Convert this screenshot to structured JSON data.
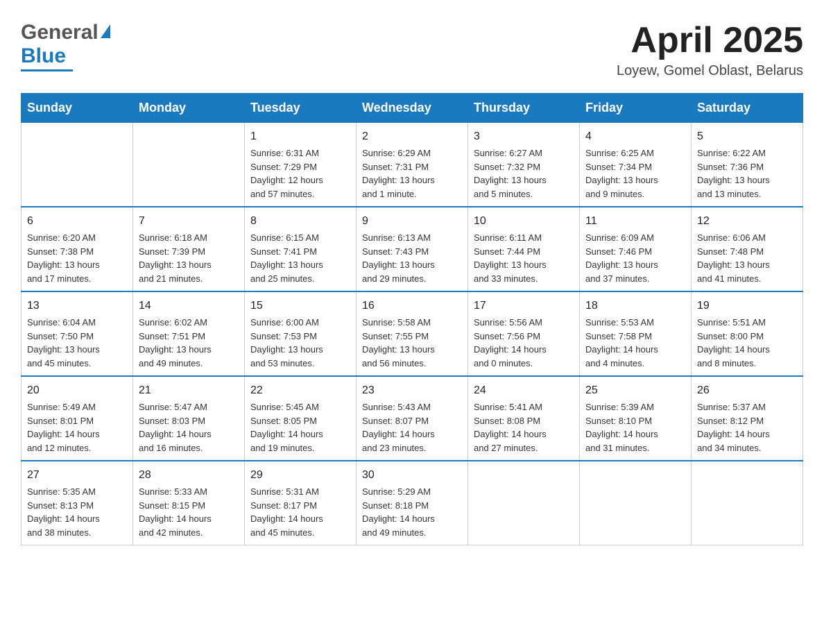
{
  "header": {
    "logo_text1": "General",
    "logo_text2": "Blue",
    "title": "April 2025",
    "subtitle": "Loyew, Gomel Oblast, Belarus"
  },
  "calendar": {
    "days_of_week": [
      "Sunday",
      "Monday",
      "Tuesday",
      "Wednesday",
      "Thursday",
      "Friday",
      "Saturday"
    ],
    "weeks": [
      {
        "days": [
          {
            "number": "",
            "info": ""
          },
          {
            "number": "",
            "info": ""
          },
          {
            "number": "1",
            "info": "Sunrise: 6:31 AM\nSunset: 7:29 PM\nDaylight: 12 hours\nand 57 minutes."
          },
          {
            "number": "2",
            "info": "Sunrise: 6:29 AM\nSunset: 7:31 PM\nDaylight: 13 hours\nand 1 minute."
          },
          {
            "number": "3",
            "info": "Sunrise: 6:27 AM\nSunset: 7:32 PM\nDaylight: 13 hours\nand 5 minutes."
          },
          {
            "number": "4",
            "info": "Sunrise: 6:25 AM\nSunset: 7:34 PM\nDaylight: 13 hours\nand 9 minutes."
          },
          {
            "number": "5",
            "info": "Sunrise: 6:22 AM\nSunset: 7:36 PM\nDaylight: 13 hours\nand 13 minutes."
          }
        ]
      },
      {
        "days": [
          {
            "number": "6",
            "info": "Sunrise: 6:20 AM\nSunset: 7:38 PM\nDaylight: 13 hours\nand 17 minutes."
          },
          {
            "number": "7",
            "info": "Sunrise: 6:18 AM\nSunset: 7:39 PM\nDaylight: 13 hours\nand 21 minutes."
          },
          {
            "number": "8",
            "info": "Sunrise: 6:15 AM\nSunset: 7:41 PM\nDaylight: 13 hours\nand 25 minutes."
          },
          {
            "number": "9",
            "info": "Sunrise: 6:13 AM\nSunset: 7:43 PM\nDaylight: 13 hours\nand 29 minutes."
          },
          {
            "number": "10",
            "info": "Sunrise: 6:11 AM\nSunset: 7:44 PM\nDaylight: 13 hours\nand 33 minutes."
          },
          {
            "number": "11",
            "info": "Sunrise: 6:09 AM\nSunset: 7:46 PM\nDaylight: 13 hours\nand 37 minutes."
          },
          {
            "number": "12",
            "info": "Sunrise: 6:06 AM\nSunset: 7:48 PM\nDaylight: 13 hours\nand 41 minutes."
          }
        ]
      },
      {
        "days": [
          {
            "number": "13",
            "info": "Sunrise: 6:04 AM\nSunset: 7:50 PM\nDaylight: 13 hours\nand 45 minutes."
          },
          {
            "number": "14",
            "info": "Sunrise: 6:02 AM\nSunset: 7:51 PM\nDaylight: 13 hours\nand 49 minutes."
          },
          {
            "number": "15",
            "info": "Sunrise: 6:00 AM\nSunset: 7:53 PM\nDaylight: 13 hours\nand 53 minutes."
          },
          {
            "number": "16",
            "info": "Sunrise: 5:58 AM\nSunset: 7:55 PM\nDaylight: 13 hours\nand 56 minutes."
          },
          {
            "number": "17",
            "info": "Sunrise: 5:56 AM\nSunset: 7:56 PM\nDaylight: 14 hours\nand 0 minutes."
          },
          {
            "number": "18",
            "info": "Sunrise: 5:53 AM\nSunset: 7:58 PM\nDaylight: 14 hours\nand 4 minutes."
          },
          {
            "number": "19",
            "info": "Sunrise: 5:51 AM\nSunset: 8:00 PM\nDaylight: 14 hours\nand 8 minutes."
          }
        ]
      },
      {
        "days": [
          {
            "number": "20",
            "info": "Sunrise: 5:49 AM\nSunset: 8:01 PM\nDaylight: 14 hours\nand 12 minutes."
          },
          {
            "number": "21",
            "info": "Sunrise: 5:47 AM\nSunset: 8:03 PM\nDaylight: 14 hours\nand 16 minutes."
          },
          {
            "number": "22",
            "info": "Sunrise: 5:45 AM\nSunset: 8:05 PM\nDaylight: 14 hours\nand 19 minutes."
          },
          {
            "number": "23",
            "info": "Sunrise: 5:43 AM\nSunset: 8:07 PM\nDaylight: 14 hours\nand 23 minutes."
          },
          {
            "number": "24",
            "info": "Sunrise: 5:41 AM\nSunset: 8:08 PM\nDaylight: 14 hours\nand 27 minutes."
          },
          {
            "number": "25",
            "info": "Sunrise: 5:39 AM\nSunset: 8:10 PM\nDaylight: 14 hours\nand 31 minutes."
          },
          {
            "number": "26",
            "info": "Sunrise: 5:37 AM\nSunset: 8:12 PM\nDaylight: 14 hours\nand 34 minutes."
          }
        ]
      },
      {
        "days": [
          {
            "number": "27",
            "info": "Sunrise: 5:35 AM\nSunset: 8:13 PM\nDaylight: 14 hours\nand 38 minutes."
          },
          {
            "number": "28",
            "info": "Sunrise: 5:33 AM\nSunset: 8:15 PM\nDaylight: 14 hours\nand 42 minutes."
          },
          {
            "number": "29",
            "info": "Sunrise: 5:31 AM\nSunset: 8:17 PM\nDaylight: 14 hours\nand 45 minutes."
          },
          {
            "number": "30",
            "info": "Sunrise: 5:29 AM\nSunset: 8:18 PM\nDaylight: 14 hours\nand 49 minutes."
          },
          {
            "number": "",
            "info": ""
          },
          {
            "number": "",
            "info": ""
          },
          {
            "number": "",
            "info": ""
          }
        ]
      }
    ]
  }
}
